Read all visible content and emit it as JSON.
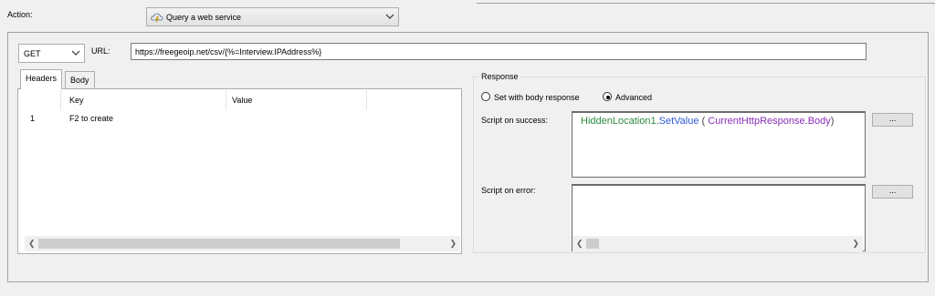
{
  "action": {
    "label": "Action:",
    "selected": "Query a web service",
    "icon": "cloud-lightning-icon"
  },
  "request": {
    "method": "GET",
    "url_label": "URL:",
    "url_value": "https://freegeoip.net/csv/{%=Interview.IPAddress%}"
  },
  "tabs": [
    {
      "label": "Headers",
      "active": true
    },
    {
      "label": "Body",
      "active": false
    }
  ],
  "headers_grid": {
    "columns": [
      "Key",
      "Value"
    ],
    "rows": [
      {
        "num": "1",
        "key": "F2 to create",
        "value": ""
      }
    ]
  },
  "response": {
    "legend": "Response",
    "options": [
      {
        "label": "Set with body response",
        "selected": false
      },
      {
        "label": "Advanced",
        "selected": true
      }
    ],
    "success_label": "Script on success:",
    "success_code": {
      "obj": "HiddenLocation1",
      "dot": ".",
      "method": "SetValue",
      "open": " ( ",
      "arg_obj": "CurrentHttpResponse",
      "arg_dot": ".",
      "arg_prop": "Body",
      "close": ")"
    },
    "error_label": "Script on error:",
    "error_code": "",
    "button_label": "..."
  },
  "colors": {
    "code_object": "#2b8a3e",
    "code_method": "#2f5bd6",
    "code_argument": "#8a2fb8"
  }
}
